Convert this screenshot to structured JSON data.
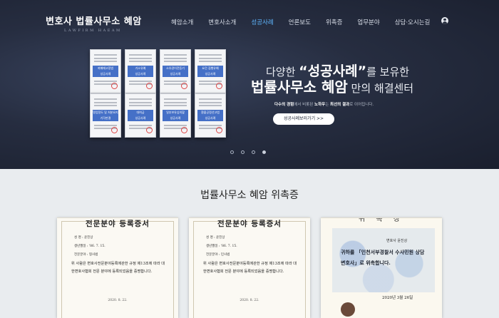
{
  "header": {
    "logo": "변호사 법률사무소 혜암",
    "logo_sub": "LAWFIRM HAEAM",
    "nav": [
      "혜암소개",
      "변호사소개",
      "성공사례",
      "언론보도",
      "위촉증",
      "업무분야",
      "상담·오시는길"
    ],
    "active_nav": "성공사례",
    "user_icon": "user-circle-icon"
  },
  "hero": {
    "cards": [
      "뢰매매고정법",
      "기소유예",
      "소유권이전등기",
      "요건 집행유예",
      "명업정도 및 처분요지 기각판결",
      "대여금",
      "일부보유심의할",
      "환불공정선고법"
    ],
    "card_badge": "성공사례",
    "line1_pre": "다양한 ",
    "line1_em": "“성공사례”",
    "line1_post": "를 보유한",
    "line2_em": "법률사무소 혜암",
    "line2_post": " 만의 해결센터",
    "desc_b1": "다수의 경험",
    "desc_t1": "에서 비롯된 ",
    "desc_b2": "노하우",
    "desc_t2": "는 ",
    "desc_b3": "최선의 결과",
    "desc_t3": "로 이어집니다.",
    "button": "성공사례보러가기 >>",
    "slides": 4,
    "active_slide": 4
  },
  "section": {
    "title": "법률사무소 혜암 위촉증"
  },
  "certificates": [
    {
      "title": "전문분야 등록증서",
      "lines": [
        "성    명 : 윤진상",
        "생년월일 : '86. 7. 15.",
        "전문분야 : 형사법"
      ],
      "body": "위 사람은 변호사전문분야등록에관한 규정 제13조에 따라 대한변호사협회 전문 분야에 등록되었음을 증명합니다.",
      "date": "2020. 8. 22."
    },
    {
      "title": "전문분야 등록증서",
      "lines": [
        "성    명 : 윤진상",
        "생년월일 : '86. 7. 15.",
        "전문분야 : 민사법"
      ],
      "body": "위 사람은 변호사전문분야등록에관한 규정 제13조에 따라 대한변호사협회 전문 분야에 등록되었음을 증명합니다.",
      "date": "2020. 8. 22."
    },
    {
      "title": "위 촉 장",
      "name": "변호사 윤진상",
      "body": "귀하를 「인천서부경찰서 수사민원 상담 변호사」로 위촉합니다.",
      "date": "2020년 3월 26일"
    }
  ]
}
